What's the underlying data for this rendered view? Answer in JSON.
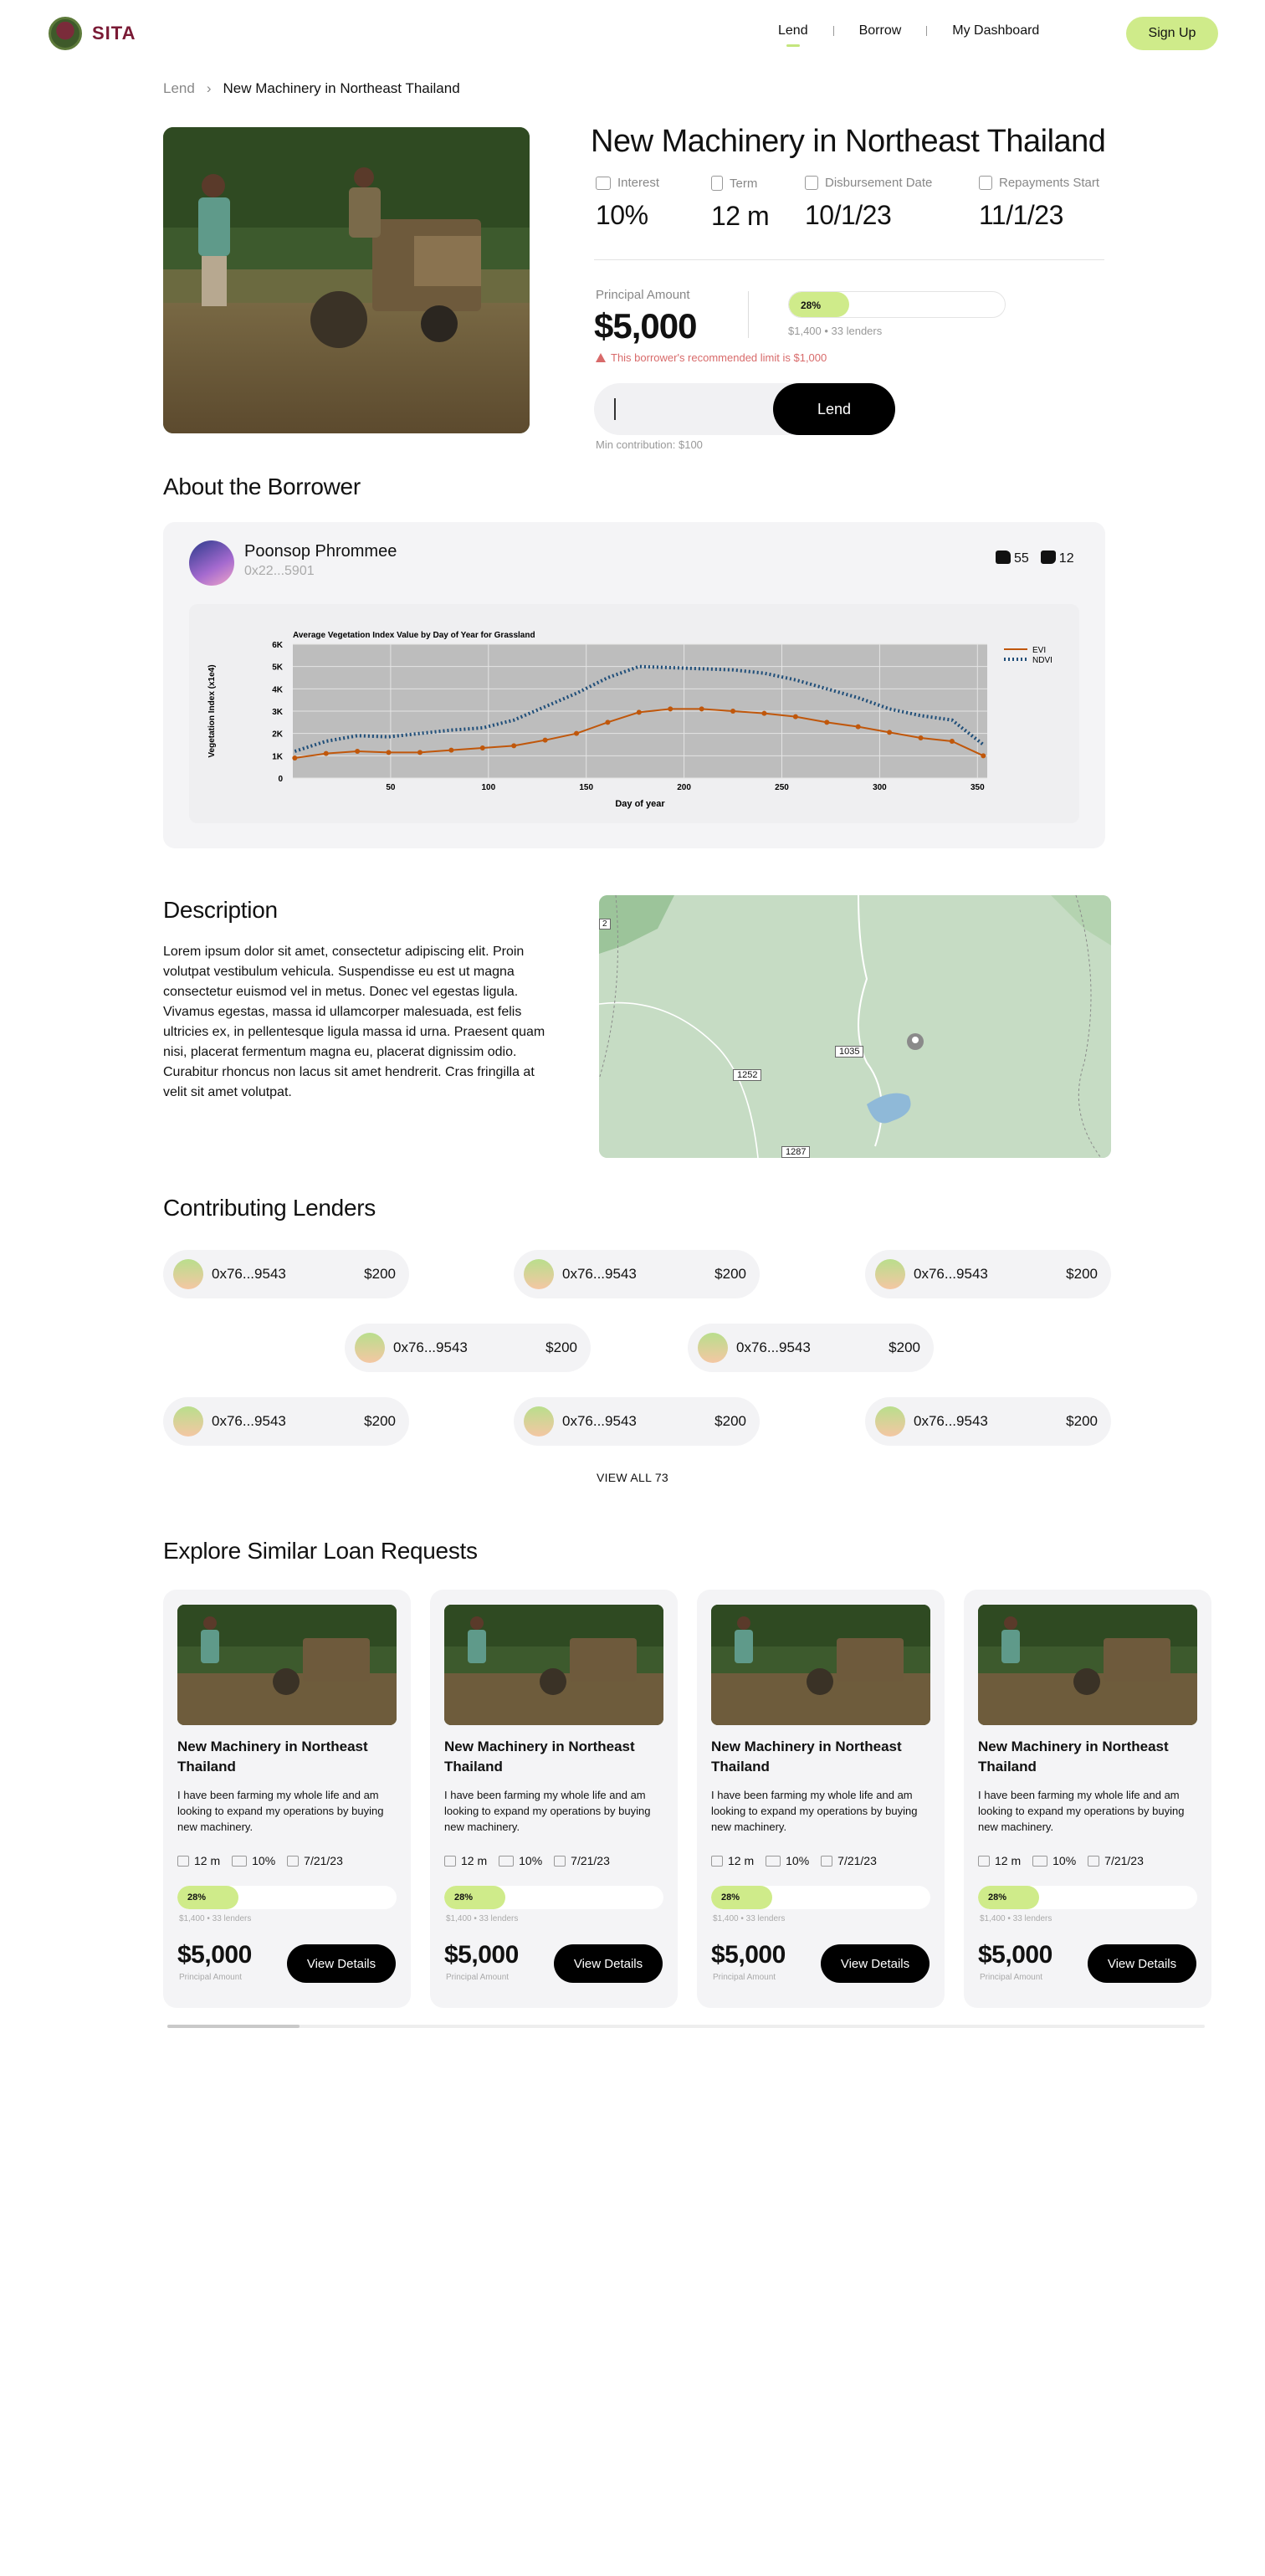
{
  "brand": {
    "name": "SITA"
  },
  "nav": {
    "lend": "Lend",
    "borrow": "Borrow",
    "dashboard": "My Dashboard",
    "signup": "Sign Up"
  },
  "breadcrumb": {
    "parent": "Lend",
    "separator": "›",
    "current": "New Machinery in Northeast Thailand"
  },
  "loan": {
    "title": "New Machinery in Northeast Thailand",
    "stats": [
      {
        "label": "Interest",
        "value": "10%",
        "icon": "money-icon"
      },
      {
        "label": "Term",
        "value": "12 m",
        "icon": "document-icon"
      },
      {
        "label": "Disbursement Date",
        "value": "10/1/23",
        "icon": "calendar-icon"
      },
      {
        "label": "Repayments Start",
        "value": "11/1/23",
        "icon": "calendar-icon"
      }
    ],
    "principal_label": "Principal Amount",
    "principal_value": "$5,000",
    "progress_label": "28%",
    "progress_fraction": 0.28,
    "progress_sub": "$1,400  •  33 lenders",
    "warning": "This borrower's recommended limit is $1,000",
    "lend_button": "Lend",
    "min_contribution": "Min contribution: $100"
  },
  "borrower": {
    "section_title": "About the Borrower",
    "name": "Poonsop Phrommee",
    "address": "0x22...5901",
    "upvotes": "55",
    "downvotes": "12"
  },
  "chart_data": {
    "type": "line",
    "title": "Average Vegetation Index Value by Day of Year for Grassland",
    "xlabel": "Day of year",
    "ylabel": "Vegetation Index (x1e4)",
    "xlim": [
      0,
      355
    ],
    "ylim": [
      0,
      6000
    ],
    "x_ticks": [
      "50",
      "100",
      "150",
      "200",
      "250",
      "300",
      "350"
    ],
    "y_ticks": [
      "0",
      "1K",
      "2K",
      "3K",
      "4K",
      "5K",
      "6K"
    ],
    "legend_position": "top-right",
    "grid": true,
    "series": [
      {
        "name": "EVI",
        "color": "#c0570b",
        "style": "line-markers",
        "x": [
          1,
          17,
          33,
          49,
          65,
          81,
          97,
          113,
          129,
          145,
          161,
          177,
          193,
          209,
          225,
          241,
          257,
          273,
          289,
          305,
          321,
          337,
          353
        ],
        "y": [
          900,
          1100,
          1200,
          1150,
          1150,
          1250,
          1350,
          1450,
          1700,
          2000,
          2500,
          2950,
          3100,
          3100,
          3000,
          2900,
          2750,
          2500,
          2300,
          2050,
          1800,
          1650,
          1000
        ]
      },
      {
        "name": "NDVI",
        "color": "#1f4e79",
        "style": "dotted",
        "x": [
          1,
          17,
          33,
          49,
          65,
          81,
          97,
          113,
          129,
          145,
          161,
          177,
          193,
          209,
          225,
          241,
          257,
          273,
          289,
          305,
          321,
          337,
          353
        ],
        "y": [
          1200,
          1650,
          1900,
          1850,
          2000,
          2150,
          2250,
          2600,
          3200,
          3800,
          4500,
          5000,
          4950,
          4900,
          4850,
          4700,
          4400,
          4000,
          3600,
          3100,
          2800,
          2600,
          1500
        ]
      }
    ]
  },
  "description": {
    "title": "Description",
    "text": "Lorem ipsum dolor sit amet, consectetur adipiscing elit. Proin volutpat vestibulum vehicula. Suspendisse eu est ut magna consectetur euismod vel in metus. Donec vel egestas ligula. Vivamus egestas, massa id ullamcorper malesuada, est felis ultricies ex, in pellentesque ligula massa id urna. Praesent quam nisi, placerat fermentum magna eu, placerat dignissim odio. Curabitur rhoncus non lacus sit amet hendrerit. Cras fringilla at velit sit amet volutpat."
  },
  "map": {
    "labels": [
      "2",
      "1035",
      "1252",
      "1287"
    ]
  },
  "lenders": {
    "title": "Contributing Lenders",
    "items": [
      {
        "address": "0x76...9543",
        "amount": "$200"
      },
      {
        "address": "0x76...9543",
        "amount": "$200"
      },
      {
        "address": "0x76...9543",
        "amount": "$200"
      },
      {
        "address": "0x76...9543",
        "amount": "$200"
      },
      {
        "address": "0x76...9543",
        "amount": "$200"
      },
      {
        "address": "0x76...9543",
        "amount": "$200"
      },
      {
        "address": "0x76...9543",
        "amount": "$200"
      },
      {
        "address": "0x76...9543",
        "amount": "$200"
      }
    ],
    "view_all": "VIEW ALL 73"
  },
  "explore": {
    "title": "Explore Similar Loan Requests",
    "cards": [
      {
        "title": "New Machinery in Northeast Thailand",
        "desc": "I have been farming my whole life and am looking to expand my operations by buying new machinery.",
        "term": "12 m",
        "interest": "10%",
        "date": "7/21/23",
        "progress_label": "28%",
        "progress_fraction": 0.28,
        "sub": "$1,400  •  33 lenders",
        "amount": "$5,000",
        "amount_label": "Principal Amount",
        "button": "View Details"
      },
      {
        "title": "New Machinery in Northeast Thailand",
        "desc": "I have been farming my whole life and am looking to expand my operations by buying new machinery.",
        "term": "12 m",
        "interest": "10%",
        "date": "7/21/23",
        "progress_label": "28%",
        "progress_fraction": 0.28,
        "sub": "$1,400  •  33 lenders",
        "amount": "$5,000",
        "amount_label": "Principal Amount",
        "button": "View Details"
      },
      {
        "title": "New Machinery in Northeast Thailand",
        "desc": "I have been farming my whole life and am looking to expand my operations by buying new machinery.",
        "term": "12 m",
        "interest": "10%",
        "date": "7/21/23",
        "progress_label": "28%",
        "progress_fraction": 0.28,
        "sub": "$1,400  •  33 lenders",
        "amount": "$5,000",
        "amount_label": "Principal Amount",
        "button": "View Details"
      },
      {
        "title": "New Machinery in Northeast Thailand",
        "desc": "I have been farming my whole life and am looking to expand my operations by buying new machinery.",
        "term": "12 m",
        "interest": "10%",
        "date": "7/21/23",
        "progress_label": "28%",
        "progress_fraction": 0.28,
        "sub": "$1,400  •  33 lenders",
        "amount": "$5,000",
        "amount_label": "Principal Amount",
        "button": "View Details"
      }
    ]
  },
  "colors": {
    "accent": "#cfeb8a",
    "brand": "#7a1a35",
    "warning": "#d86a6a"
  }
}
